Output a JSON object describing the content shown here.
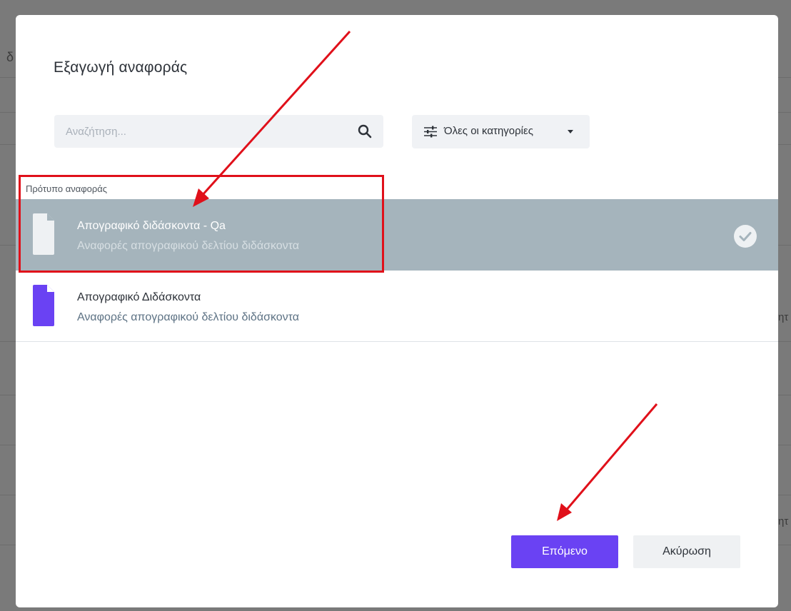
{
  "background": {
    "fragments": [
      "δ",
      "ητ",
      "ητ"
    ]
  },
  "modal": {
    "title": "Εξαγωγή αναφοράς",
    "search": {
      "placeholder": "Αναζήτηση...",
      "icon": "search-icon"
    },
    "category_filter": {
      "label": "Όλες οι κατηγορίες",
      "icon": "sliders-icon"
    },
    "section_label": "Πρότυπο αναφοράς",
    "reports": [
      {
        "title": "Απογραφικό διδάσκοντα - Qa",
        "subtitle": "Αναφορές απογραφικού δελτίου διδάσκοντα",
        "selected": true,
        "icon_color": "#eef1f3"
      },
      {
        "title": "Απογραφικό Διδάσκοντα",
        "subtitle": "Αναφορές απογραφικού δελτίου διδάσκοντα",
        "selected": false,
        "icon_color": "#6a42f3"
      }
    ],
    "buttons": {
      "next": "Επόμενο",
      "cancel": "Ακύρωση"
    }
  },
  "colors": {
    "accent": "#6a42f3",
    "selected_row": "#a5b4bc",
    "annotation_red": "#e0101a"
  }
}
